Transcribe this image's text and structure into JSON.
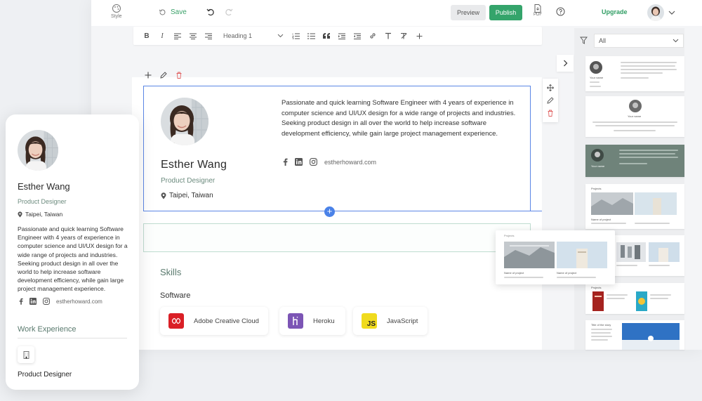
{
  "toolbar": {
    "style_label": "Style",
    "save_label": "Save",
    "preview_label": "Preview",
    "publish_label": "Publish",
    "pdf_label": "PDF",
    "upgrade_label": "Upgrade"
  },
  "editor": {
    "heading_select": "Heading 1",
    "buttons": [
      "B",
      "I",
      "align-left",
      "align-center",
      "align-right",
      "ordered-list",
      "bullet-list",
      "quote",
      "indent",
      "outdent",
      "link",
      "text",
      "clear-format",
      "plus"
    ]
  },
  "resume": {
    "name": "Esther Wang",
    "role": "Product Designer",
    "location": "Taipei, Taiwan",
    "summary": "Passionate and quick learning Software Engineer with 4 years of experience in computer science and UI/UX design for a wide range of projects and industries. Seeking product design in all over the world to help increase software development efficiency, while gain large project management experience.",
    "website": "estherhoward.com",
    "skills_title": "Skills",
    "software_title": "Software",
    "skills": [
      {
        "name": "Adobe Creative Cloud",
        "logo": "adobe-cc-icon",
        "color": "#da1f26"
      },
      {
        "name": "Heroku",
        "logo": "heroku-icon",
        "color": "#7c55b5"
      },
      {
        "name": "JavaScript",
        "logo": "JS",
        "color": "#f0db1e"
      }
    ]
  },
  "mobile": {
    "work_title": "Work Experience",
    "work_role": "Product Designer"
  },
  "templates": {
    "filter_value": "All",
    "t1_name": "Your name",
    "t2_name": "Your name",
    "t3_name": "Your name",
    "projects_label": "Projects",
    "project_name": "Name of project",
    "title_of_story": "Title of the story"
  },
  "popup": {
    "label": "Projects",
    "project_a": "Name of project",
    "project_b": "Name of project"
  },
  "colors": {
    "accent_green": "#34a46b",
    "selection_blue": "#5b86e5",
    "role_green": "#6c8b7e"
  }
}
